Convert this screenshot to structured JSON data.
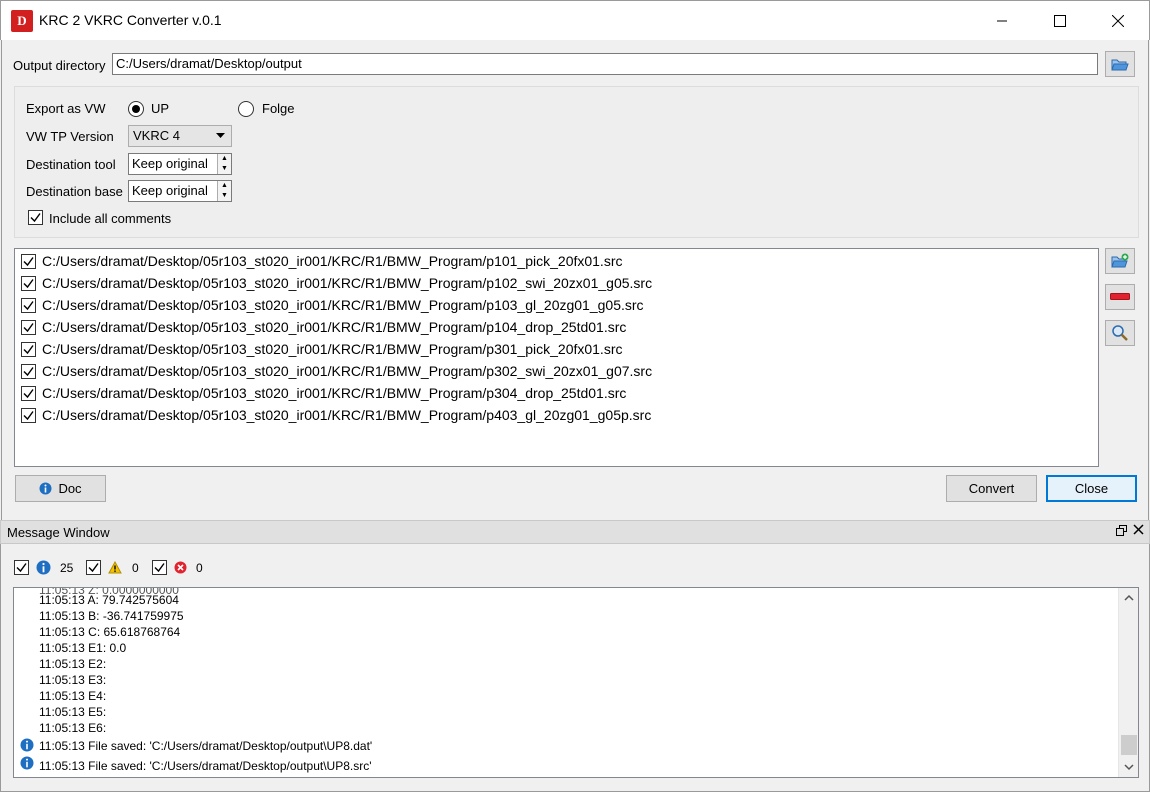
{
  "window": {
    "title": "KRC 2 VKRC Converter v.0.1",
    "logo_text": "D"
  },
  "output": {
    "label": "Output directory",
    "value": "C:/Users/dramat/Desktop/output"
  },
  "options": {
    "export_label": "Export as VW",
    "radio_up": "UP",
    "radio_folge": "Folge",
    "selected_export": "UP",
    "tp_version_label": "VW TP Version",
    "tp_version_value": "VKRC 4",
    "dest_tool_label": "Destination tool",
    "dest_tool_value": "Keep original",
    "dest_base_label": "Destination base",
    "dest_base_value": "Keep original",
    "include_comments_label": "Include all comments",
    "include_comments_checked": true
  },
  "files": [
    "C:/Users/dramat/Desktop/05r103_st020_ir001/KRC/R1/BMW_Program/p101_pick_20fx01.src",
    "C:/Users/dramat/Desktop/05r103_st020_ir001/KRC/R1/BMW_Program/p102_swi_20zx01_g05.src",
    "C:/Users/dramat/Desktop/05r103_st020_ir001/KRC/R1/BMW_Program/p103_gl_20zg01_g05.src",
    "C:/Users/dramat/Desktop/05r103_st020_ir001/KRC/R1/BMW_Program/p104_drop_25td01.src",
    "C:/Users/dramat/Desktop/05r103_st020_ir001/KRC/R1/BMW_Program/p301_pick_20fx01.src",
    "C:/Users/dramat/Desktop/05r103_st020_ir001/KRC/R1/BMW_Program/p302_swi_20zx01_g07.src",
    "C:/Users/dramat/Desktop/05r103_st020_ir001/KRC/R1/BMW_Program/p304_drop_25td01.src",
    "C:/Users/dramat/Desktop/05r103_st020_ir001/KRC/R1/BMW_Program/p403_gl_20zg01_g05p.src"
  ],
  "buttons": {
    "doc": "Doc",
    "convert": "Convert",
    "close": "Close"
  },
  "message_window": {
    "title": "Message Window",
    "info_count": "25",
    "warning_count": "0",
    "error_count": "0",
    "log": [
      {
        "text": "11:05:13 A: 79.742575604",
        "icon": ""
      },
      {
        "text": "11:05:13 B: -36.741759975",
        "icon": ""
      },
      {
        "text": "11:05:13 C: 65.618768764",
        "icon": ""
      },
      {
        "text": "11:05:13 E1: 0.0",
        "icon": ""
      },
      {
        "text": "11:05:13 E2:",
        "icon": ""
      },
      {
        "text": "11:05:13 E3:",
        "icon": ""
      },
      {
        "text": "11:05:13 E4:",
        "icon": ""
      },
      {
        "text": "11:05:13 E5:",
        "icon": ""
      },
      {
        "text": "11:05:13 E6:",
        "icon": ""
      },
      {
        "text": "11:05:13 File saved: 'C:/Users/dramat/Desktop/output\\UP8.dat'",
        "icon": "info-icon"
      },
      {
        "text": "11:05:13 File saved: 'C:/Users/dramat/Desktop/output\\UP8.src'",
        "icon": "info-icon"
      }
    ]
  },
  "colors": {
    "accent": "#0078d7",
    "logo_red": "#d21f1f",
    "info_blue": "#1e6fc2",
    "warning_yellow": "#f2c200",
    "error_red": "#e0232e"
  }
}
